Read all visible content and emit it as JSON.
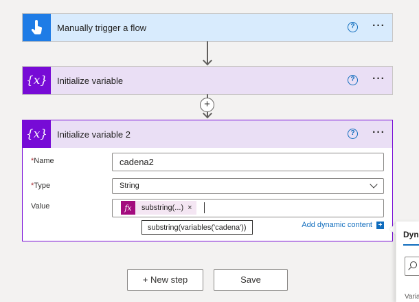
{
  "steps": [
    {
      "title": "Manually trigger a flow",
      "help": "?",
      "more": "···"
    },
    {
      "title": "Initialize variable",
      "help": "?",
      "more": "···",
      "icon_text": "{x}"
    },
    {
      "title": "Initialize variable 2",
      "help": "?",
      "more": "···",
      "icon_text": "{x}"
    }
  ],
  "form": {
    "name_label": "Name",
    "name_value": "cadena2",
    "type_label": "Type",
    "type_value": "String",
    "value_label": "Value",
    "required_mark": "*",
    "token_fx": "fx",
    "token_text": "substring(...)",
    "token_close": "×",
    "tooltip": "substring(variables('cadena'))",
    "dynamic_link": "Add dynamic content",
    "dynamic_plus": "+"
  },
  "connector": {
    "plus": "+"
  },
  "buttons": {
    "new_step": "+ New step",
    "save": "Save"
  },
  "side_panel": {
    "tab_label": "Dyn",
    "section_label": "Varia"
  },
  "colors": {
    "trigger_header": "#d8ebfd",
    "trigger_icon": "#1e7ce6",
    "variable_header": "#eadff5",
    "variable_icon": "#770bd6",
    "expression_token": "#a30c7e",
    "link": "#0f6cbd"
  },
  "icons": {
    "trigger": "hand-touch-icon",
    "variable": "variable-icon",
    "help": "help-circle-icon",
    "more": "more-ellipsis-icon",
    "dropdown": "chevron-down-icon",
    "search": "search-icon"
  }
}
